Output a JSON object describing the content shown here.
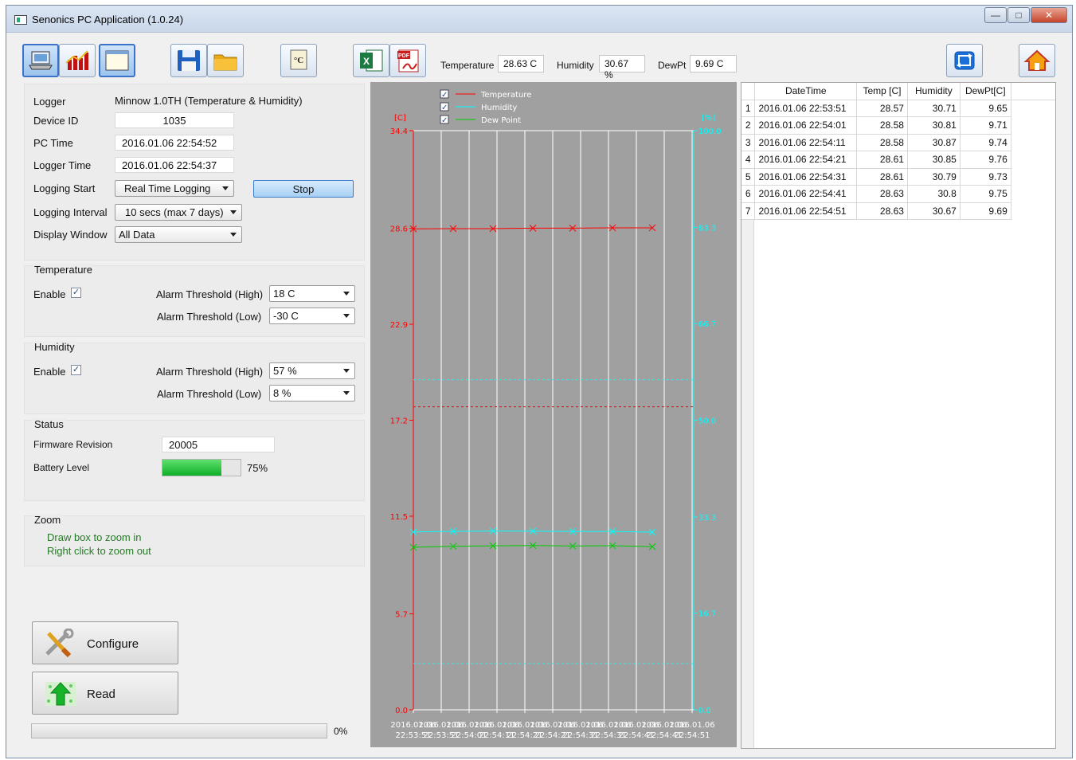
{
  "window": {
    "title": "Senonics PC Application (1.0.24)"
  },
  "toolbar": {
    "temperature_label": "Temperature",
    "temperature_value": "28.63 C",
    "humidity_label": "Humidity",
    "humidity_value": "30.67 %",
    "dewpt_label": "DewPt",
    "dewpt_value": "9.69 C",
    "excel_icon_text": "X",
    "pdf_icon_text": "PDF",
    "celsius_icon_text": "°C"
  },
  "logger": {
    "logger_label": "Logger",
    "logger_value": "Minnow 1.0TH (Temperature & Humidity)",
    "device_id_label": "Device ID",
    "device_id_value": "1035",
    "pc_time_label": "PC Time",
    "pc_time_value": "2016.01.06 22:54:52",
    "logger_time_label": "Logger Time",
    "logger_time_value": "2016.01.06 22:54:37",
    "logging_start_label": "Logging Start",
    "logging_start_value": "Real Time Logging",
    "stop_label": "Stop",
    "logging_interval_label": "Logging Interval",
    "logging_interval_value": "10 secs (max 7 days)",
    "display_window_label": "Display Window",
    "display_window_value": "All Data"
  },
  "temperature": {
    "title": "Temperature",
    "enable_label": "Enable",
    "enable_checked": true,
    "high_label": "Alarm Threshold (High)",
    "high_value": "18 C",
    "low_label": "Alarm Threshold (Low)",
    "low_value": "-30 C"
  },
  "humidity": {
    "title": "Humidity",
    "enable_label": "Enable",
    "enable_checked": true,
    "high_label": "Alarm Threshold (High)",
    "high_value": "57 %",
    "low_label": "Alarm Threshold (Low)",
    "low_value": "8 %"
  },
  "status": {
    "title": "Status",
    "firmware_label": "Firmware Revision",
    "firmware_value": "20005",
    "battery_label": "Battery Level",
    "battery_text": "75%",
    "battery_level": 0.75
  },
  "zoom": {
    "title": "Zoom",
    "line1": "Draw box to zoom in",
    "line2": "Right click to zoom out"
  },
  "actions": {
    "configure_label": "Configure",
    "read_label": "Read",
    "progress_text": "0%",
    "progress_level": 0
  },
  "colors": {
    "temperature": "#ff0000",
    "humidity": "#00ffff",
    "dewpoint": "#00cc00",
    "chart_bg": "#a0a0a0",
    "battery": "#22c43a"
  },
  "table": {
    "headers": [
      "DateTime",
      "Temp [C]",
      "Humidity",
      "DewPt[C]"
    ],
    "rows": [
      [
        "1",
        "2016.01.06  22:53:51",
        "28.57",
        "30.71",
        "9.65"
      ],
      [
        "2",
        "2016.01.06  22:54:01",
        "28.58",
        "30.81",
        "9.71"
      ],
      [
        "3",
        "2016.01.06  22:54:11",
        "28.58",
        "30.87",
        "9.74"
      ],
      [
        "4",
        "2016.01.06  22:54:21",
        "28.61",
        "30.85",
        "9.76"
      ],
      [
        "5",
        "2016.01.06  22:54:31",
        "28.61",
        "30.79",
        "9.73"
      ],
      [
        "6",
        "2016.01.06  22:54:41",
        "28.63",
        "30.8",
        "9.75"
      ],
      [
        "7",
        "2016.01.06  22:54:51",
        "28.63",
        "30.67",
        "9.69"
      ]
    ]
  },
  "chart_data": {
    "type": "line",
    "legend": [
      "Temperature",
      "Humidity",
      "Dew Point"
    ],
    "legend_placement": "top-left",
    "left_axis_unit": "[C]",
    "right_axis_unit": "[%]",
    "left_ticks": [
      "0.0",
      "5.7",
      "11.5",
      "17.2",
      "22.9",
      "28.6",
      "34.4"
    ],
    "right_ticks": [
      "0.0",
      "16.7",
      "33.3",
      "50.0",
      "66.7",
      "83.3",
      "100.0"
    ],
    "ylim_left": [
      0,
      34.4
    ],
    "ylim_right": [
      0,
      100
    ],
    "x_labels_date": [
      "2016.01.06",
      "2016.01.06",
      "2016.01.06",
      "2016.01.06",
      "2016.01.06",
      "2016.01.06",
      "2016.01.06",
      "2016.01.06",
      "2016.01.06",
      "2016.01.06",
      "2016.01.06"
    ],
    "x_labels_time": [
      "22:53:51",
      "22:53:51",
      "22:54:01",
      "22:54:11",
      "22:54:21",
      "22:54:21",
      "22:54:31",
      "22:54:31",
      "22:54:41",
      "22:54:41",
      "22:54:51"
    ],
    "grid": true,
    "series": [
      {
        "name": "Temperature",
        "axis": "left",
        "values": [
          28.57,
          28.58,
          28.58,
          28.61,
          28.61,
          28.63,
          28.63
        ]
      },
      {
        "name": "Humidity",
        "axis": "right",
        "values": [
          30.71,
          30.81,
          30.87,
          30.85,
          30.79,
          30.8,
          30.67
        ]
      },
      {
        "name": "Dew Point",
        "axis": "left",
        "values": [
          9.65,
          9.71,
          9.74,
          9.76,
          9.73,
          9.75,
          9.69
        ]
      }
    ],
    "alarm_lines": [
      {
        "series": "Temperature",
        "axis": "left",
        "value": 18
      },
      {
        "series": "Humidity",
        "axis": "right",
        "value": 57
      },
      {
        "series": "Humidity",
        "axis": "right",
        "value": 8
      }
    ]
  }
}
